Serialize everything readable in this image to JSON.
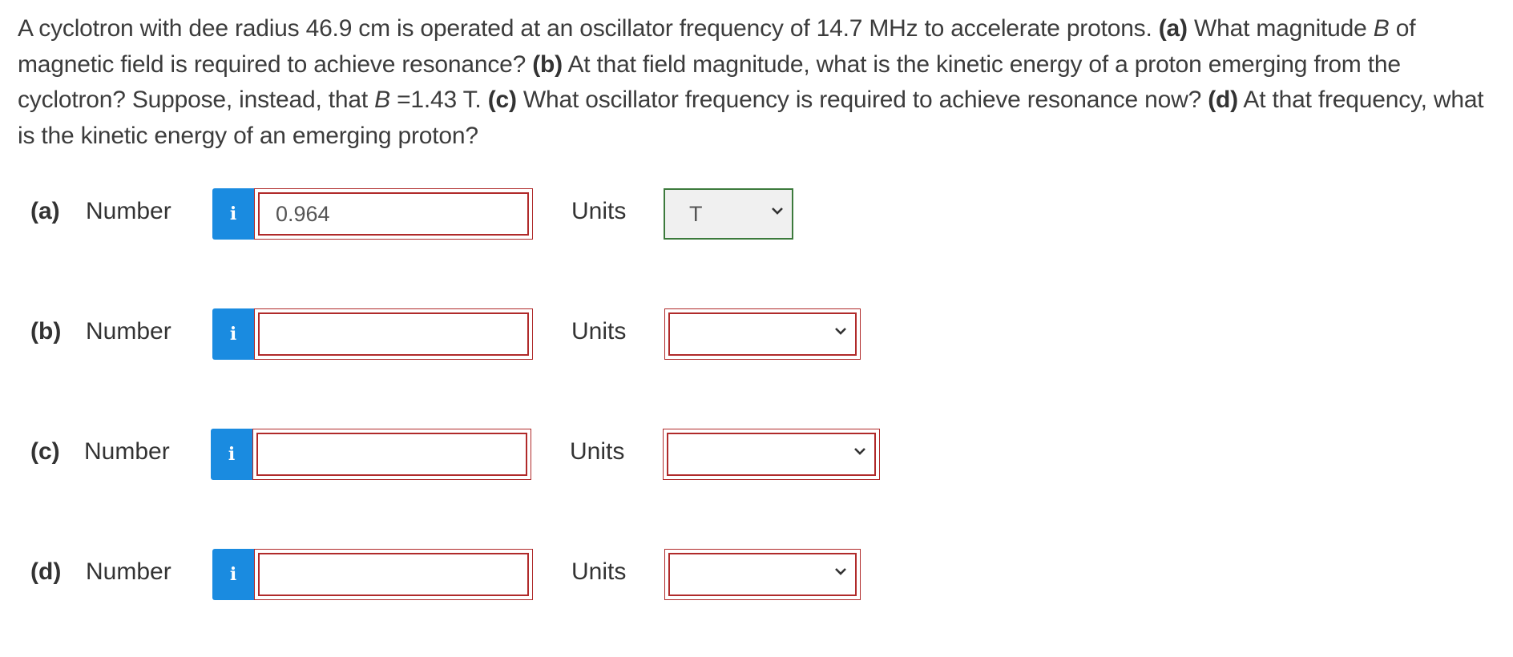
{
  "question": {
    "t1": "A cyclotron with dee radius 46.9 cm is operated at an oscillator frequency of 14.7 MHz to accelerate protons. ",
    "pa": "(a)",
    "t2": " What magnitude ",
    "b1": "B",
    "t3": " of magnetic field is required to achieve resonance? ",
    "pb": "(b)",
    "t4": " At that field magnitude, what is the kinetic energy of a proton emerging from the cyclotron? Suppose, instead, that ",
    "b2": "B",
    "t5": " =1.43 T. ",
    "pc": "(c)",
    "t6": " What oscillator frequency is required to achieve resonance now? ",
    "pd": "(d)",
    "t7": " At that frequency, what is the kinetic energy of an emerging proton?"
  },
  "rows": [
    {
      "part": "(a)",
      "number_label": "Number",
      "info": "i",
      "value": "0.964",
      "units_label": "Units",
      "unit_selected": "T"
    },
    {
      "part": "(b)",
      "number_label": "Number",
      "info": "i",
      "value": "",
      "units_label": "Units",
      "unit_selected": ""
    },
    {
      "part": "(c)",
      "number_label": "Number",
      "info": "i",
      "value": "",
      "units_label": "Units",
      "unit_selected": ""
    },
    {
      "part": "(d)",
      "number_label": "Number",
      "info": "i",
      "value": "",
      "units_label": "Units",
      "unit_selected": ""
    }
  ],
  "colors": {
    "info_bg": "#1a8be0",
    "error_border": "#b02a2a",
    "ok_border": "#3c7a3c"
  }
}
